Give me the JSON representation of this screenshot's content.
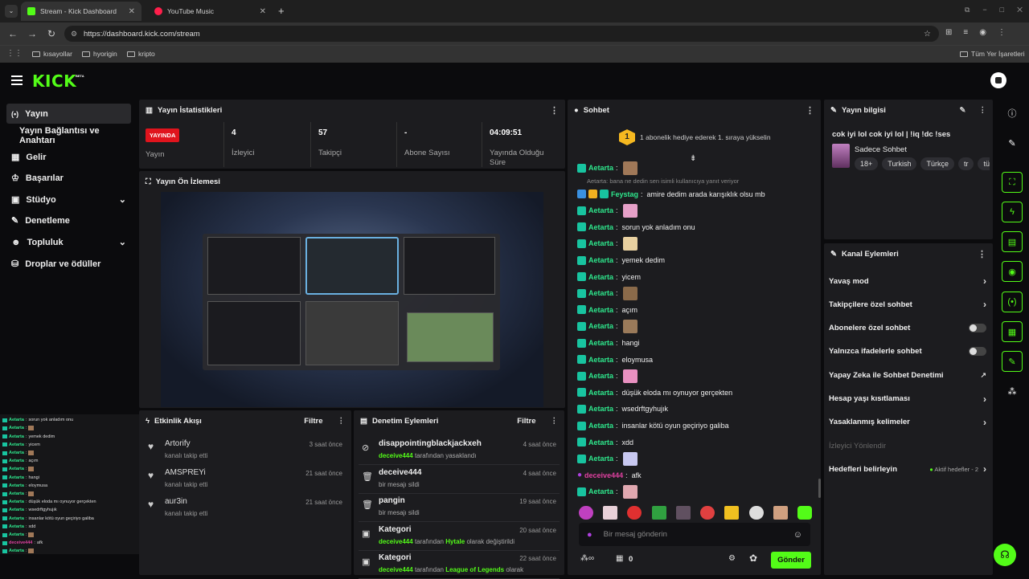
{
  "browser": {
    "tabs": [
      {
        "title": "Stream - Kick Dashboard"
      },
      {
        "title": "YouTube Music"
      }
    ],
    "url": "https://dashboard.kick.com/stream",
    "bookmarks": [
      "kısayollar",
      "hyorigin",
      "kripto"
    ],
    "all_bookmarks": "Tüm Yer İşaretleri"
  },
  "app": {
    "logo": "KICK",
    "logo_badge": "BETA"
  },
  "sidebar": {
    "items": [
      {
        "label": "Yayın",
        "icon": "broadcast-icon"
      },
      {
        "label": "Yayın Bağlantısı ve Anahtarı",
        "icon": ""
      },
      {
        "label": "Gelir",
        "icon": "revenue-icon"
      },
      {
        "label": "Başarılar",
        "icon": "trophy-icon"
      },
      {
        "label": "Stüdyo",
        "icon": "studio-icon"
      },
      {
        "label": "Denetleme",
        "icon": "wrench-icon"
      },
      {
        "label": "Topluluk",
        "icon": "community-icon"
      },
      {
        "label": "Droplar ve ödüller",
        "icon": "drops-icon"
      }
    ]
  },
  "stats": {
    "title": "Yayın İstatistikleri",
    "live_badge": "YAYINDA",
    "live_label": "Yayın",
    "viewers": "4",
    "viewers_label": "İzleyici",
    "followers": "57",
    "followers_label": "Takipçi",
    "subs": "-",
    "subs_label": "Abone Sayısı",
    "uptime": "04:09:51",
    "uptime_label": "Yayında Olduğu Süre"
  },
  "preview": {
    "title": "Yayın Ön İzlemesi"
  },
  "activity": {
    "title": "Etkinlik Akışı",
    "filter": "Filtre",
    "items": [
      {
        "name": "Artorify",
        "action": "kanalı takip etti",
        "time": "3 saat önce"
      },
      {
        "name": "AMSPREYi",
        "action": "kanalı takip etti",
        "time": "21 saat önce"
      },
      {
        "name": "aur3in",
        "action": "kanalı takip etti",
        "time": "21 saat önce"
      }
    ]
  },
  "moderation": {
    "title": "Denetim Eylemleri",
    "filter": "Filtre",
    "items": [
      {
        "title": "disappointingblackjackxeh",
        "actor": "deceive444",
        "rest": "tarafından yasaklandı",
        "time": "4 saat önce"
      },
      {
        "title": "deceive444",
        "actor": "",
        "rest": "bir mesajı sildi",
        "time": "4 saat önce"
      },
      {
        "title": "pangin",
        "actor": "",
        "rest": "bir mesajı sildi",
        "time": "19 saat önce"
      },
      {
        "title": "Kategori",
        "actor": "deceive444",
        "rest": "tarafından",
        "highlight": "Hytale",
        "rest2": "olarak değiştirildi",
        "time": "20 saat önce"
      },
      {
        "title": "Kategori",
        "actor": "deceive444",
        "rest": "tarafından",
        "highlight": "League of Legends",
        "rest2": "olarak",
        "time": "22 saat önce"
      }
    ]
  },
  "chat": {
    "title": "Sohbet",
    "gift_rank": "1",
    "gift_text": "1 abonelik hediye ederek 1. sıraya yükselin",
    "reply_note": "Aetarta: bana ne dedin sen isimli kullanıcıya yanıt veriyor",
    "messages": [
      {
        "user": "Aetarta",
        "text": "",
        "emote": "#a07858"
      },
      {
        "user": "Feystag",
        "text": "amire dedim arada karışıklık olsu mb",
        "emote": ""
      },
      {
        "user": "Aetarta",
        "text": "",
        "emote": "#e6a0c8"
      },
      {
        "user": "Aetarta",
        "text": "sorun yok anladım onu",
        "emote": ""
      },
      {
        "user": "Aetarta",
        "text": "",
        "emote": "#e8d0a0"
      },
      {
        "user": "Aetarta",
        "text": "yemek dedim",
        "emote": ""
      },
      {
        "user": "Aetarta",
        "text": "yicem",
        "emote": ""
      },
      {
        "user": "Aetarta",
        "text": "",
        "emote": "#8a6a4a"
      },
      {
        "user": "Aetarta",
        "text": "açım",
        "emote": ""
      },
      {
        "user": "Aetarta",
        "text": "",
        "emote": "#9a7a5a"
      },
      {
        "user": "Aetarta",
        "text": "hangi",
        "emote": ""
      },
      {
        "user": "Aetarta",
        "text": "eloymusa",
        "emote": ""
      },
      {
        "user": "Aetarta",
        "text": "",
        "emote": "#e890c0"
      },
      {
        "user": "Aetarta",
        "text": "düşük eloda mı oynuyor gerçekten",
        "emote": ""
      },
      {
        "user": "Aetarta",
        "text": "wsedrftgyhujık",
        "emote": ""
      },
      {
        "user": "Aetarta",
        "text": "insanlar kötü oyun geçiriyo galiba",
        "emote": ""
      },
      {
        "user": "Aetarta",
        "text": "xdd",
        "emote": ""
      },
      {
        "user": "Aetarta",
        "text": "",
        "emote": "#c8c8f0"
      },
      {
        "user": "deceive444",
        "text": "afk",
        "emote": ""
      },
      {
        "user": "Aetarta",
        "text": "",
        "emote": "#e0a8b0"
      }
    ],
    "input_placeholder": "Bir mesaj gönderin",
    "points": "0",
    "send": "Gönder"
  },
  "stream_info": {
    "title": "Yayın bilgisi",
    "stream_title": "cok iyi lol cok iyi lol | !iq !dc !ses",
    "category": "Sadece Sohbet",
    "tags": [
      "18+",
      "Turkish",
      "Türkçe",
      "tr",
      "tü"
    ]
  },
  "channel_actions": {
    "title": "Kanal Eylemleri",
    "items": [
      {
        "label": "Yavaş mod",
        "control": "chevron"
      },
      {
        "label": "Takipçilere özel sohbet",
        "control": "chevron"
      },
      {
        "label": "Abonelere özel sohbet",
        "control": "toggle"
      },
      {
        "label": "Yalnızca ifadelerle sohbet",
        "control": "toggle"
      },
      {
        "label": "Yapay Zeka ile Sohbet Denetimi",
        "control": "external"
      },
      {
        "label": "Hesap yaşı kısıtlaması",
        "control": "chevron"
      },
      {
        "label": "Yasaklanmış kelimeler",
        "control": "chevron"
      },
      {
        "label": "İzleyici Yönlendir",
        "control": "disabled"
      },
      {
        "label": "Hedefleri belirleyin",
        "control": "chevron",
        "status": "Aktif hedefler - 2"
      }
    ]
  },
  "overlay_chat": [
    {
      "user": "Aetarta",
      "text": "sorun yok anladım onu"
    },
    {
      "user": "Aetarta",
      "text": ""
    },
    {
      "user": "Aetarta",
      "text": "yemek dedim"
    },
    {
      "user": "Aetarta",
      "text": "yicem"
    },
    {
      "user": "Aetarta",
      "text": ""
    },
    {
      "user": "Aetarta",
      "text": "açım"
    },
    {
      "user": "Aetarta",
      "text": ""
    },
    {
      "user": "Aetarta",
      "text": "hangi"
    },
    {
      "user": "Aetarta",
      "text": "eloymusa"
    },
    {
      "user": "Aetarta",
      "text": ""
    },
    {
      "user": "Aetarta",
      "text": "düşük eloda mı oynuyor gerçekten"
    },
    {
      "user": "Aetarta",
      "text": "wsedrftgyhujık"
    },
    {
      "user": "Aetarta",
      "text": "insanlar kötü oyun geçiriyo galiba"
    },
    {
      "user": "Aetarta",
      "text": "xdd"
    },
    {
      "user": "Aetarta",
      "text": ""
    },
    {
      "user": "deceive444",
      "text": "afk"
    },
    {
      "user": "Aetarta",
      "text": ""
    }
  ]
}
